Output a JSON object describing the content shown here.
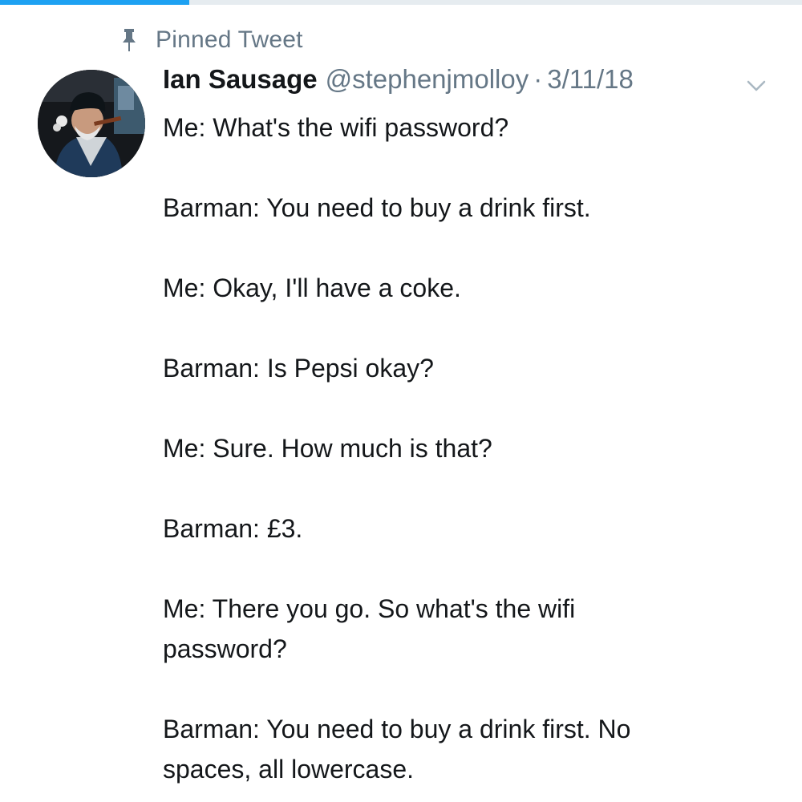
{
  "pinned": {
    "label": "Pinned Tweet",
    "icon": "pin-icon"
  },
  "tweet": {
    "author_name": "Ian Sausage",
    "handle": "@stephenjmolloy",
    "separator": "·",
    "date": "3/11/18",
    "caret_icon": "chevron-down-icon",
    "avatar": "avatar",
    "paragraphs": [
      [
        "Me: What's the wifi password?"
      ],
      [
        "Barman: You need to buy a drink first."
      ],
      [
        "Me: Okay, I'll have a coke."
      ],
      [
        "Barman: Is Pepsi okay?"
      ],
      [
        "Me: Sure. How much is that?"
      ],
      [
        "Barman: £3."
      ],
      [
        "Me: There you go. So what's the wifi",
        "password?"
      ],
      [
        "Barman: You need to buy a drink first. No",
        "spaces, all lowercase."
      ]
    ]
  },
  "colors": {
    "accent": "#1da1f2",
    "text_primary": "#14171a",
    "text_secondary": "#657786",
    "divider": "#e6ecf0"
  }
}
